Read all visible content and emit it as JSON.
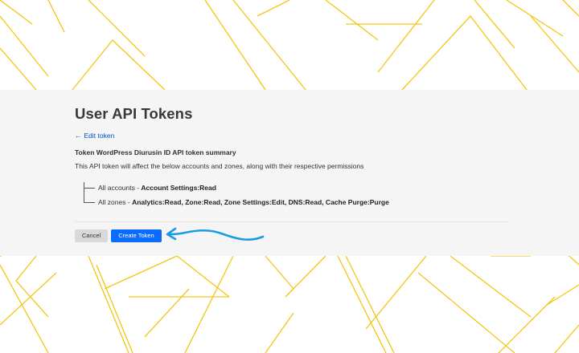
{
  "page": {
    "title": "User API Tokens",
    "back_link_arrow": "←",
    "back_link_label": "Edit token"
  },
  "summary": {
    "heading": "Token WordPress Diurusin ID API token summary",
    "description": "This API token will affect the below accounts and zones, along with their respective permissions"
  },
  "permissions": [
    {
      "scope": "All accounts",
      "separator": " - ",
      "perms": "Account Settings:Read"
    },
    {
      "scope": "All zones",
      "separator": " - ",
      "perms": "Analytics:Read, Zone:Read, Zone Settings:Edit, DNS:Read, Cache Purge:Purge"
    }
  ],
  "actions": {
    "cancel_label": "Cancel",
    "create_label": "Create Token"
  },
  "colors": {
    "link": "#0051c3",
    "primary_button": "#0a6cff",
    "annotation_arrow": "#1a9be6",
    "background_lines": "#f3c614"
  },
  "icons": {
    "back": "arrow-left-icon",
    "annotation": "curved-arrow-icon"
  }
}
